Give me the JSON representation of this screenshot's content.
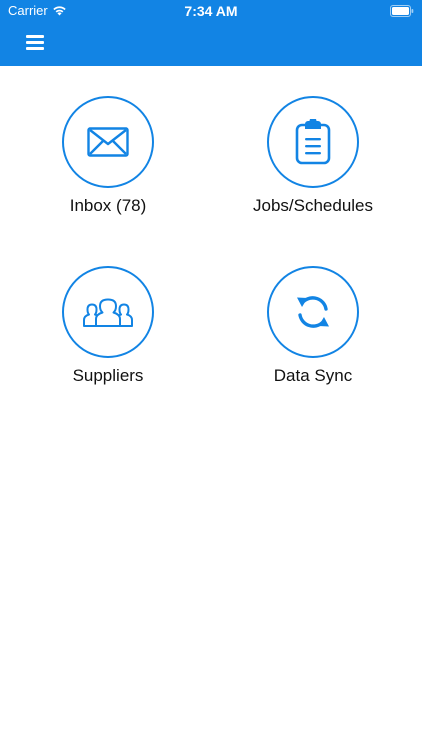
{
  "status_bar": {
    "carrier": "Carrier",
    "time": "7:34 AM",
    "wifi_icon": "wifi-icon",
    "battery_icon": "battery-icon"
  },
  "nav": {
    "menu_icon": "hamburger-menu-icon",
    "background_color": "#1284e4"
  },
  "tiles": [
    {
      "label": "Inbox (78)",
      "icon": "envelope-icon"
    },
    {
      "label": "Jobs/Schedules",
      "icon": "clipboard-icon"
    },
    {
      "label": "Suppliers",
      "icon": "people-group-icon"
    },
    {
      "label": "Data Sync",
      "icon": "sync-icon"
    }
  ],
  "colors": {
    "accent": "#1284e4",
    "text": "#111111",
    "background": "#ffffff"
  }
}
